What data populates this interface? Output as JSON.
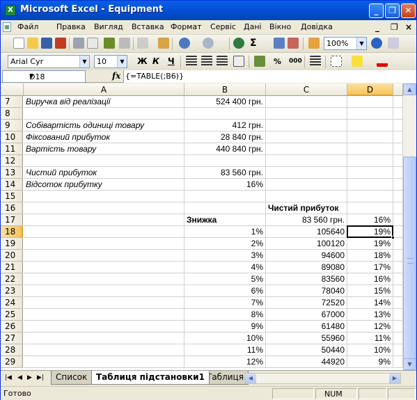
{
  "window": {
    "title": "Microsoft Excel - Equipment",
    "app_icon": "X"
  },
  "menu": {
    "items": [
      "Файл",
      "Правка",
      "Вигляд",
      "Вставка",
      "Формат",
      "Сервіс",
      "Дані",
      "Вікно",
      "Довідка"
    ],
    "mdi_minimize": "_",
    "mdi_restore": "❐",
    "mdi_close": "×"
  },
  "standard_toolbar": {
    "zoom": "100%",
    "sum_symbol": "Σ"
  },
  "format_toolbar": {
    "font": "Arial Cyr",
    "size": "10",
    "bold": "Ж",
    "italic": "К",
    "underline": "Ч",
    "percent": "%",
    "thousands": "000"
  },
  "formula_bar": {
    "name_box": "D18",
    "fx": "fx",
    "formula": "{=TABLE(;B6)}"
  },
  "columns": [
    "A",
    "B",
    "C",
    "D"
  ],
  "selected_column": "D",
  "selected_row": "18",
  "rows": [
    {
      "num": "7",
      "a": "Виручка від реалізації",
      "b": "524 400 грн.",
      "c": "",
      "d": ""
    },
    {
      "num": "8",
      "a": "",
      "b": "",
      "c": "",
      "d": ""
    },
    {
      "num": "9",
      "a": "Собівартість одиниці товару",
      "b": "412 грн.",
      "c": "",
      "d": ""
    },
    {
      "num": "10",
      "a": "Фіксований прибуток",
      "b": "28 840 грн.",
      "c": "",
      "d": ""
    },
    {
      "num": "11",
      "a": "Вартість товару",
      "b": "440 840 грн.",
      "c": "",
      "d": ""
    },
    {
      "num": "12",
      "a": "",
      "b": "",
      "c": "",
      "d": ""
    },
    {
      "num": "13",
      "a": "Чистий прибуток",
      "b": "83 560 грн.",
      "c": "",
      "d": ""
    },
    {
      "num": "14",
      "a": "Відсоток прибутку",
      "b": "16%",
      "c": "",
      "d": ""
    },
    {
      "num": "15",
      "a": "",
      "b": "",
      "c": "",
      "d": ""
    },
    {
      "num": "16",
      "a": "",
      "b": "",
      "c": "Чистий прибуток",
      "d": ""
    },
    {
      "num": "17",
      "a": "",
      "b": "Знижка",
      "c": "83 560 грн.",
      "d": "16%"
    },
    {
      "num": "18",
      "a": "",
      "b": "1%",
      "c": "105640",
      "d": "19%"
    },
    {
      "num": "19",
      "a": "",
      "b": "2%",
      "c": "100120",
      "d": "19%"
    },
    {
      "num": "20",
      "a": "",
      "b": "3%",
      "c": "94600",
      "d": "18%"
    },
    {
      "num": "21",
      "a": "",
      "b": "4%",
      "c": "89080",
      "d": "17%"
    },
    {
      "num": "22",
      "a": "",
      "b": "5%",
      "c": "83560",
      "d": "16%"
    },
    {
      "num": "23",
      "a": "",
      "b": "6%",
      "c": "78040",
      "d": "15%"
    },
    {
      "num": "24",
      "a": "",
      "b": "7%",
      "c": "72520",
      "d": "14%"
    },
    {
      "num": "25",
      "a": "",
      "b": "8%",
      "c": "67000",
      "d": "13%"
    },
    {
      "num": "26",
      "a": "",
      "b": "9%",
      "c": "61480",
      "d": "12%"
    },
    {
      "num": "27",
      "a": "",
      "b": "10%",
      "c": "55960",
      "d": "11%"
    },
    {
      "num": "28",
      "a": "",
      "b": "11%",
      "c": "50440",
      "d": "10%"
    },
    {
      "num": "29",
      "a": "",
      "b": "12%",
      "c": "44920",
      "d": "9%"
    }
  ],
  "sheet_tabs": [
    "Список",
    "Таблиця підстановки1",
    "Таблиця"
  ],
  "active_tab": "Таблиця підстановки1",
  "status": {
    "text": "Готово",
    "num": "NUM"
  },
  "colors": {
    "title_bar": "#0453d8",
    "selection_header": "#f6c45a",
    "grid_line": "#d0d0d0"
  }
}
